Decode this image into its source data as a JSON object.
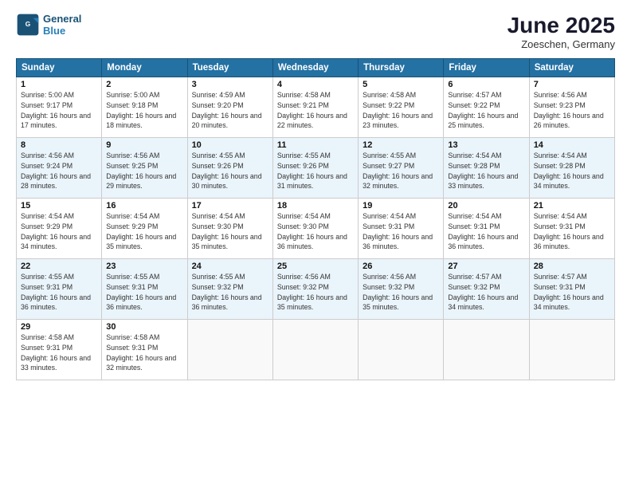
{
  "header": {
    "logo_line1": "General",
    "logo_line2": "Blue",
    "month": "June 2025",
    "location": "Zoeschen, Germany"
  },
  "weekdays": [
    "Sunday",
    "Monday",
    "Tuesday",
    "Wednesday",
    "Thursday",
    "Friday",
    "Saturday"
  ],
  "weeks": [
    [
      {
        "day": "1",
        "sunrise": "Sunrise: 5:00 AM",
        "sunset": "Sunset: 9:17 PM",
        "daylight": "Daylight: 16 hours and 17 minutes."
      },
      {
        "day": "2",
        "sunrise": "Sunrise: 5:00 AM",
        "sunset": "Sunset: 9:18 PM",
        "daylight": "Daylight: 16 hours and 18 minutes."
      },
      {
        "day": "3",
        "sunrise": "Sunrise: 4:59 AM",
        "sunset": "Sunset: 9:20 PM",
        "daylight": "Daylight: 16 hours and 20 minutes."
      },
      {
        "day": "4",
        "sunrise": "Sunrise: 4:58 AM",
        "sunset": "Sunset: 9:21 PM",
        "daylight": "Daylight: 16 hours and 22 minutes."
      },
      {
        "day": "5",
        "sunrise": "Sunrise: 4:58 AM",
        "sunset": "Sunset: 9:22 PM",
        "daylight": "Daylight: 16 hours and 23 minutes."
      },
      {
        "day": "6",
        "sunrise": "Sunrise: 4:57 AM",
        "sunset": "Sunset: 9:22 PM",
        "daylight": "Daylight: 16 hours and 25 minutes."
      },
      {
        "day": "7",
        "sunrise": "Sunrise: 4:56 AM",
        "sunset": "Sunset: 9:23 PM",
        "daylight": "Daylight: 16 hours and 26 minutes."
      }
    ],
    [
      {
        "day": "8",
        "sunrise": "Sunrise: 4:56 AM",
        "sunset": "Sunset: 9:24 PM",
        "daylight": "Daylight: 16 hours and 28 minutes."
      },
      {
        "day": "9",
        "sunrise": "Sunrise: 4:56 AM",
        "sunset": "Sunset: 9:25 PM",
        "daylight": "Daylight: 16 hours and 29 minutes."
      },
      {
        "day": "10",
        "sunrise": "Sunrise: 4:55 AM",
        "sunset": "Sunset: 9:26 PM",
        "daylight": "Daylight: 16 hours and 30 minutes."
      },
      {
        "day": "11",
        "sunrise": "Sunrise: 4:55 AM",
        "sunset": "Sunset: 9:26 PM",
        "daylight": "Daylight: 16 hours and 31 minutes."
      },
      {
        "day": "12",
        "sunrise": "Sunrise: 4:55 AM",
        "sunset": "Sunset: 9:27 PM",
        "daylight": "Daylight: 16 hours and 32 minutes."
      },
      {
        "day": "13",
        "sunrise": "Sunrise: 4:54 AM",
        "sunset": "Sunset: 9:28 PM",
        "daylight": "Daylight: 16 hours and 33 minutes."
      },
      {
        "day": "14",
        "sunrise": "Sunrise: 4:54 AM",
        "sunset": "Sunset: 9:28 PM",
        "daylight": "Daylight: 16 hours and 34 minutes."
      }
    ],
    [
      {
        "day": "15",
        "sunrise": "Sunrise: 4:54 AM",
        "sunset": "Sunset: 9:29 PM",
        "daylight": "Daylight: 16 hours and 34 minutes."
      },
      {
        "day": "16",
        "sunrise": "Sunrise: 4:54 AM",
        "sunset": "Sunset: 9:29 PM",
        "daylight": "Daylight: 16 hours and 35 minutes."
      },
      {
        "day": "17",
        "sunrise": "Sunrise: 4:54 AM",
        "sunset": "Sunset: 9:30 PM",
        "daylight": "Daylight: 16 hours and 35 minutes."
      },
      {
        "day": "18",
        "sunrise": "Sunrise: 4:54 AM",
        "sunset": "Sunset: 9:30 PM",
        "daylight": "Daylight: 16 hours and 36 minutes."
      },
      {
        "day": "19",
        "sunrise": "Sunrise: 4:54 AM",
        "sunset": "Sunset: 9:31 PM",
        "daylight": "Daylight: 16 hours and 36 minutes."
      },
      {
        "day": "20",
        "sunrise": "Sunrise: 4:54 AM",
        "sunset": "Sunset: 9:31 PM",
        "daylight": "Daylight: 16 hours and 36 minutes."
      },
      {
        "day": "21",
        "sunrise": "Sunrise: 4:54 AM",
        "sunset": "Sunset: 9:31 PM",
        "daylight": "Daylight: 16 hours and 36 minutes."
      }
    ],
    [
      {
        "day": "22",
        "sunrise": "Sunrise: 4:55 AM",
        "sunset": "Sunset: 9:31 PM",
        "daylight": "Daylight: 16 hours and 36 minutes."
      },
      {
        "day": "23",
        "sunrise": "Sunrise: 4:55 AM",
        "sunset": "Sunset: 9:31 PM",
        "daylight": "Daylight: 16 hours and 36 minutes."
      },
      {
        "day": "24",
        "sunrise": "Sunrise: 4:55 AM",
        "sunset": "Sunset: 9:32 PM",
        "daylight": "Daylight: 16 hours and 36 minutes."
      },
      {
        "day": "25",
        "sunrise": "Sunrise: 4:56 AM",
        "sunset": "Sunset: 9:32 PM",
        "daylight": "Daylight: 16 hours and 35 minutes."
      },
      {
        "day": "26",
        "sunrise": "Sunrise: 4:56 AM",
        "sunset": "Sunset: 9:32 PM",
        "daylight": "Daylight: 16 hours and 35 minutes."
      },
      {
        "day": "27",
        "sunrise": "Sunrise: 4:57 AM",
        "sunset": "Sunset: 9:32 PM",
        "daylight": "Daylight: 16 hours and 34 minutes."
      },
      {
        "day": "28",
        "sunrise": "Sunrise: 4:57 AM",
        "sunset": "Sunset: 9:31 PM",
        "daylight": "Daylight: 16 hours and 34 minutes."
      }
    ],
    [
      {
        "day": "29",
        "sunrise": "Sunrise: 4:58 AM",
        "sunset": "Sunset: 9:31 PM",
        "daylight": "Daylight: 16 hours and 33 minutes."
      },
      {
        "day": "30",
        "sunrise": "Sunrise: 4:58 AM",
        "sunset": "Sunset: 9:31 PM",
        "daylight": "Daylight: 16 hours and 32 minutes."
      },
      null,
      null,
      null,
      null,
      null
    ]
  ]
}
